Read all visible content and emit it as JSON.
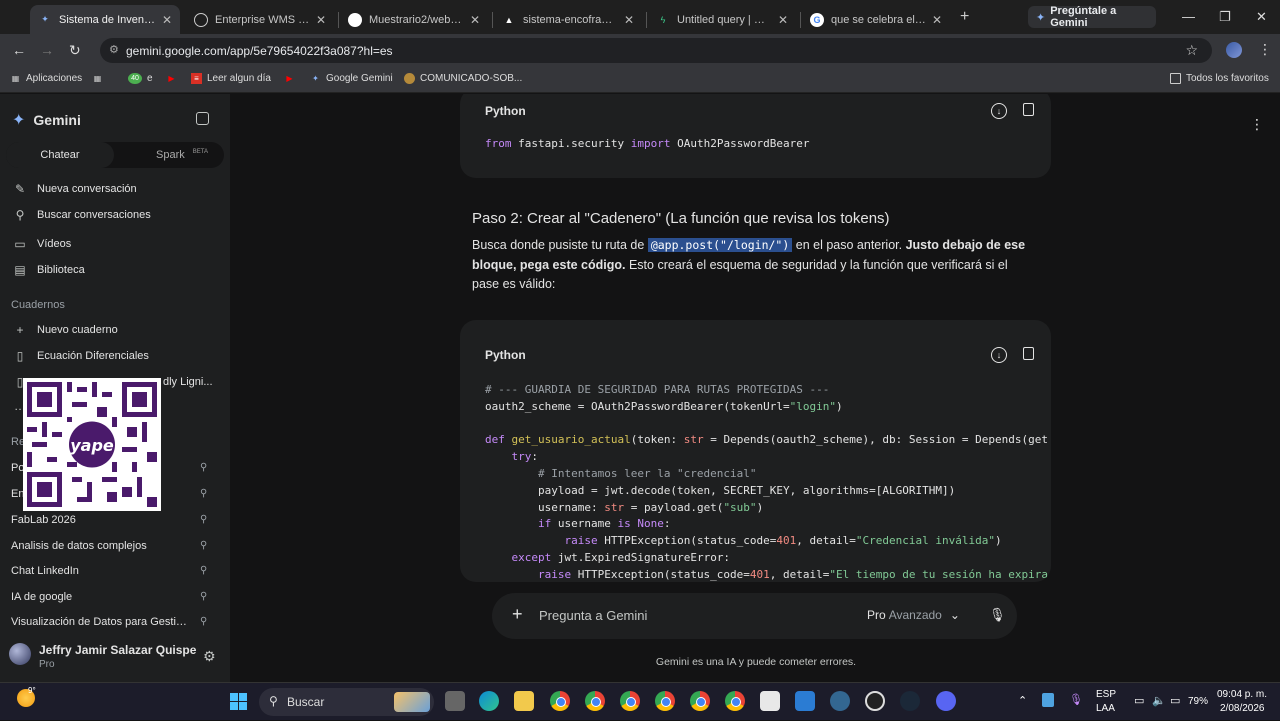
{
  "browser": {
    "tabs": [
      {
        "title": "Sistema de Inventario y",
        "favicon": "gemini",
        "active": true
      },
      {
        "title": "Enterprise WMS | Cont",
        "favicon": "globe"
      },
      {
        "title": "Muestrario2/web-enco",
        "favicon": "github"
      },
      {
        "title": "sistema-encofrados · V",
        "favicon": "vercel"
      },
      {
        "title": "Untitled query | SQL Ed",
        "favicon": "supabase"
      },
      {
        "title": "que se celebra el 1 de",
        "favicon": "google"
      }
    ],
    "new_tab": "+",
    "ask_gemini": "Pregúntale a Gemini",
    "url": "gemini.google.com/app/5e79654022f3a087?hl=es",
    "bookmarks": [
      "Aplicaciones",
      "e",
      "Leer algun día",
      "Google Gemini",
      "COMUNICADO-SOB..."
    ],
    "bookmark_badge": "40",
    "all_bookmarks": "Todos los favoritos"
  },
  "sidebar": {
    "brand": "Gemini",
    "modes": {
      "chat": "Chatear",
      "spark": "Spark",
      "beta": "BETA"
    },
    "nav": [
      {
        "label": "Nueva conversación",
        "icon": "edit-icon"
      },
      {
        "label": "Buscar conversaciones",
        "icon": "search-icon"
      },
      {
        "label": "Vídeos",
        "icon": "video-icon"
      },
      {
        "label": "Biblioteca",
        "icon": "library-icon"
      }
    ],
    "notebooks_label": "Cuadernos",
    "notebooks": [
      {
        "label": "Nuevo cuaderno",
        "icon": "plus-icon"
      },
      {
        "label": "Ecuación Diferenciales",
        "icon": "notebook-icon"
      },
      {
        "label": "dly Ligni...",
        "icon": "notebook-icon"
      }
    ],
    "recent_label": "Re",
    "recents": [
      "Po",
      "En",
      "FabLab 2026",
      "Analisis de datos complejos",
      "Chat LinkedIn",
      "IA de google",
      "Visualización de Datos para Gestió..."
    ],
    "qr_label": "yape",
    "user": {
      "name": "Jeffry Jamir Salazar Quispe",
      "plan": "Pro"
    }
  },
  "main": {
    "code1": {
      "lang": "Python",
      "line": "from fastapi.security import OAuth2PasswordBearer"
    },
    "heading": "Paso 2: Crear al \"Cadenero\" (La función que revisa los tokens)",
    "body": {
      "p1": "Busca donde pusiste tu ruta de ",
      "code": "@app.post(\"/login/\")",
      "p2": " en el paso anterior. ",
      "bold": "Justo debajo de ese bloque, pega este código.",
      "p3": " Esto creará el esquema de seguridad y la función que verificará si el pase es válido:"
    },
    "code2": {
      "lang": "Python"
    },
    "prompt": {
      "placeholder": "Pregunta a Gemini",
      "model": "Pro",
      "model_sub": "Avanzado"
    },
    "disclaimer": "Gemini es una IA y puede cometer errores."
  },
  "taskbar": {
    "weather_temp": "9°",
    "search": "Buscar",
    "lang": "ESP",
    "lang_sub": "LAA",
    "battery": "79%",
    "time": "09:04 p. m.",
    "date": "2/08/2026"
  }
}
